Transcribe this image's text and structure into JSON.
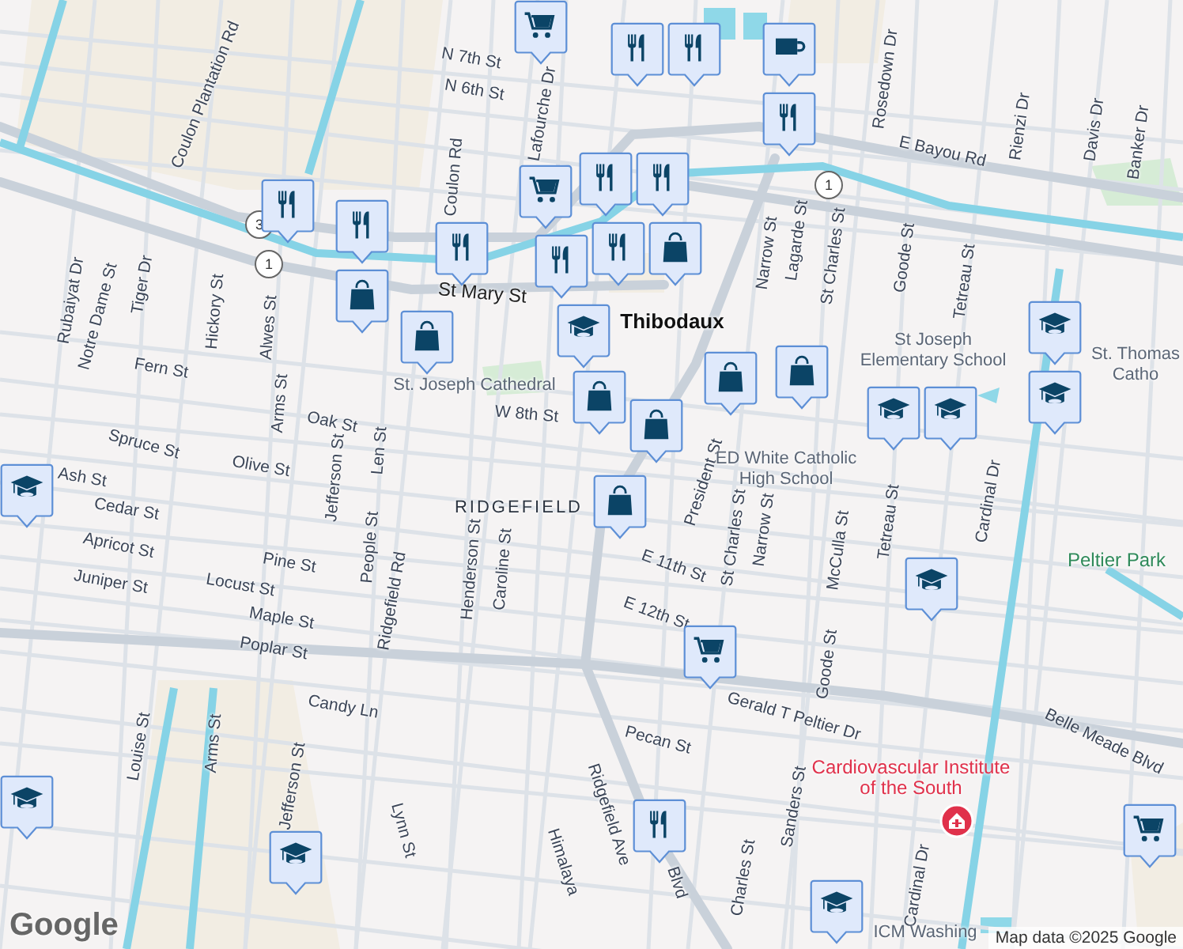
{
  "map": {
    "labels": [
      {
        "text": "N 7th St",
        "kind": "street"
      },
      {
        "text": "N 6th St",
        "kind": "street"
      },
      {
        "text": "Coulon Plantation Rd",
        "kind": "street"
      },
      {
        "text": "Lafourche Dr",
        "kind": "street"
      },
      {
        "text": "Coulon Rd",
        "kind": "street"
      },
      {
        "text": "Rubaiyat Dr",
        "kind": "street"
      },
      {
        "text": "Notre Dame St",
        "kind": "street"
      },
      {
        "text": "Tiger Dr",
        "kind": "street"
      },
      {
        "text": "Hickory St",
        "kind": "street"
      },
      {
        "text": "Alwes St",
        "kind": "street"
      },
      {
        "text": "St Mary St",
        "kind": "major"
      },
      {
        "text": "Thibodaux",
        "kind": "city"
      },
      {
        "text": "Fern St",
        "kind": "street"
      },
      {
        "text": "Arms St",
        "kind": "street"
      },
      {
        "text": "Oak St",
        "kind": "street"
      },
      {
        "text": "Len St",
        "kind": "street"
      },
      {
        "text": "Spruce St",
        "kind": "street"
      },
      {
        "text": "Olive St",
        "kind": "street"
      },
      {
        "text": "Ash St",
        "kind": "street"
      },
      {
        "text": "Cedar St",
        "kind": "street"
      },
      {
        "text": "Apricot St",
        "kind": "street"
      },
      {
        "text": "Juniper St",
        "kind": "street"
      },
      {
        "text": "Pine St",
        "kind": "street"
      },
      {
        "text": "Locust St",
        "kind": "street"
      },
      {
        "text": "Maple St",
        "kind": "street"
      },
      {
        "text": "Poplar St",
        "kind": "street"
      },
      {
        "text": "Candy Ln",
        "kind": "street"
      },
      {
        "text": "Jefferson St",
        "kind": "street"
      },
      {
        "text": "People St",
        "kind": "street"
      },
      {
        "text": "Ridgefield Rd",
        "kind": "street"
      },
      {
        "text": "Henderson St",
        "kind": "street"
      },
      {
        "text": "Caroline St",
        "kind": "street"
      },
      {
        "text": "RIDGEFIELD",
        "kind": "area"
      },
      {
        "text": "Louise St",
        "kind": "street"
      },
      {
        "text": "Arms St",
        "kind": "street"
      },
      {
        "text": "Jefferson St",
        "kind": "street"
      },
      {
        "text": "Lynn St",
        "kind": "street"
      },
      {
        "text": "Himalaya",
        "kind": "street"
      },
      {
        "text": "Ridgefield Ave",
        "kind": "street"
      },
      {
        "text": "Blvd",
        "kind": "street"
      },
      {
        "text": "W 8th St",
        "kind": "street"
      },
      {
        "text": "St. Joseph Cathedral",
        "kind": "poi"
      },
      {
        "text": "President St",
        "kind": "street"
      },
      {
        "text": "Narrow St",
        "kind": "street"
      },
      {
        "text": "Lagarde St",
        "kind": "street"
      },
      {
        "text": "St Charles St",
        "kind": "street"
      },
      {
        "text": "Goode St",
        "kind": "street"
      },
      {
        "text": "Tetreau St",
        "kind": "street"
      },
      {
        "text": "Rosedown Dr",
        "kind": "street"
      },
      {
        "text": "Rienzi Dr",
        "kind": "street"
      },
      {
        "text": "Davis Dr",
        "kind": "street"
      },
      {
        "text": "Banker Dr",
        "kind": "street"
      },
      {
        "text": "E Bayou Rd",
        "kind": "street"
      },
      {
        "text": "St Joseph Elementary School",
        "kind": "poi"
      },
      {
        "text": "St. Thomas Catho",
        "kind": "poi"
      },
      {
        "text": "ED White Catholic High School",
        "kind": "poi"
      },
      {
        "text": "Peltier Park",
        "kind": "park"
      },
      {
        "text": "E 11th St",
        "kind": "street"
      },
      {
        "text": "E 12th St",
        "kind": "street"
      },
      {
        "text": "Gerald T Peltier Dr",
        "kind": "street"
      },
      {
        "text": "Pecan St",
        "kind": "street"
      },
      {
        "text": "Belle Meade Blvd",
        "kind": "street"
      },
      {
        "text": "Cardiovascular Institute of the South",
        "kind": "medical"
      },
      {
        "text": "St Charles St",
        "kind": "street"
      },
      {
        "text": "McCulla St",
        "kind": "street"
      },
      {
        "text": "Goode St",
        "kind": "street"
      },
      {
        "text": "Sanders St",
        "kind": "street"
      },
      {
        "text": "Cardinal Dr",
        "kind": "street"
      },
      {
        "text": "Cardinal Dr",
        "kind": "street"
      },
      {
        "text": "Charles St",
        "kind": "street"
      },
      {
        "text": "Narrow St",
        "kind": "street"
      },
      {
        "text": "ICM Washing",
        "kind": "poi"
      },
      {
        "text": "Tetreau St",
        "kind": "street"
      }
    ],
    "shields": [
      "1",
      "3",
      "1"
    ],
    "pins": [
      {
        "kind": "grocery"
      },
      {
        "kind": "restaurant"
      },
      {
        "kind": "restaurant"
      },
      {
        "kind": "cafe"
      },
      {
        "kind": "restaurant"
      },
      {
        "kind": "grocery"
      },
      {
        "kind": "restaurant"
      },
      {
        "kind": "restaurant"
      },
      {
        "kind": "restaurant"
      },
      {
        "kind": "restaurant"
      },
      {
        "kind": "shopping"
      },
      {
        "kind": "restaurant"
      },
      {
        "kind": "restaurant"
      },
      {
        "kind": "restaurant"
      },
      {
        "kind": "shopping"
      },
      {
        "kind": "shopping"
      },
      {
        "kind": "school"
      },
      {
        "kind": "shopping"
      },
      {
        "kind": "shopping"
      },
      {
        "kind": "shopping"
      },
      {
        "kind": "shopping"
      },
      {
        "kind": "shopping"
      },
      {
        "kind": "school"
      },
      {
        "kind": "school"
      },
      {
        "kind": "school"
      },
      {
        "kind": "school"
      },
      {
        "kind": "school"
      },
      {
        "kind": "grocery"
      },
      {
        "kind": "school"
      },
      {
        "kind": "school"
      },
      {
        "kind": "school"
      },
      {
        "kind": "restaurant"
      },
      {
        "kind": "grocery"
      },
      {
        "kind": "school"
      }
    ],
    "logo": "Google",
    "attribution": "Map data ©2025 Google"
  }
}
